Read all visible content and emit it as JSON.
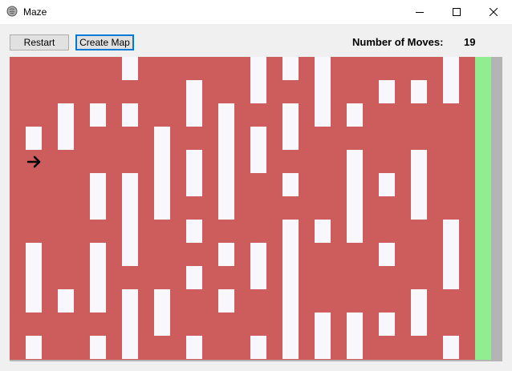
{
  "window": {
    "title": "Maze",
    "app_icon": "brain-icon",
    "controls": [
      "minimize-icon",
      "maximize-icon",
      "close-icon"
    ]
  },
  "toolbar": {
    "restart_label": "Restart",
    "create_map_label": "Create Map",
    "moves_label": "Number of Moves:",
    "moves_value": "19"
  },
  "maze": {
    "colors": {
      "floor": "#cd5c5c",
      "wall": "#f8f8fc",
      "goal": "#90ee90",
      "border": "#b4b4b4",
      "player": "#000000"
    },
    "player_icon": "arrow-right-icon",
    "player_position": {
      "row": 4,
      "col": 1
    },
    "goal_column": 29,
    "cols": 29,
    "rows": 13,
    "walls": [
      {
        "col": 1,
        "row": 3,
        "h": 1
      },
      {
        "col": 1,
        "row": 8,
        "h": 3
      },
      {
        "col": 1,
        "row": 12,
        "h": 1
      },
      {
        "col": 3,
        "row": 2,
        "h": 2
      },
      {
        "col": 3,
        "row": 10,
        "h": 1
      },
      {
        "col": 5,
        "row": 2,
        "h": 1
      },
      {
        "col": 5,
        "row": 5,
        "h": 2
      },
      {
        "col": 5,
        "row": 8,
        "h": 3
      },
      {
        "col": 5,
        "row": 12,
        "h": 1
      },
      {
        "col": 7,
        "row": 0,
        "h": 1
      },
      {
        "col": 7,
        "row": 2,
        "h": 1
      },
      {
        "col": 7,
        "row": 5,
        "h": 4
      },
      {
        "col": 7,
        "row": 10,
        "h": 3
      },
      {
        "col": 9,
        "row": 3,
        "h": 4
      },
      {
        "col": 9,
        "row": 10,
        "h": 2
      },
      {
        "col": 11,
        "row": 1,
        "h": 2
      },
      {
        "col": 11,
        "row": 4,
        "h": 2
      },
      {
        "col": 11,
        "row": 7,
        "h": 1
      },
      {
        "col": 11,
        "row": 9,
        "h": 1
      },
      {
        "col": 11,
        "row": 12,
        "h": 1
      },
      {
        "col": 13,
        "row": 2,
        "h": 5
      },
      {
        "col": 13,
        "row": 8,
        "h": 1
      },
      {
        "col": 13,
        "row": 10,
        "h": 1
      },
      {
        "col": 15,
        "row": 0,
        "h": 2
      },
      {
        "col": 15,
        "row": 3,
        "h": 2
      },
      {
        "col": 15,
        "row": 8,
        "h": 2
      },
      {
        "col": 15,
        "row": 12,
        "h": 1
      },
      {
        "col": 17,
        "row": 0,
        "h": 1
      },
      {
        "col": 17,
        "row": 2,
        "h": 2
      },
      {
        "col": 17,
        "row": 5,
        "h": 1
      },
      {
        "col": 17,
        "row": 7,
        "h": 6
      },
      {
        "col": 19,
        "row": 0,
        "h": 3
      },
      {
        "col": 19,
        "row": 7,
        "h": 1
      },
      {
        "col": 19,
        "row": 11,
        "h": 2
      },
      {
        "col": 21,
        "row": 2,
        "h": 1
      },
      {
        "col": 21,
        "row": 4,
        "h": 4
      },
      {
        "col": 21,
        "row": 11,
        "h": 2
      },
      {
        "col": 23,
        "row": 1,
        "h": 1
      },
      {
        "col": 23,
        "row": 5,
        "h": 1
      },
      {
        "col": 23,
        "row": 8,
        "h": 1
      },
      {
        "col": 23,
        "row": 11,
        "h": 1
      },
      {
        "col": 25,
        "row": 1,
        "h": 1
      },
      {
        "col": 25,
        "row": 4,
        "h": 3
      },
      {
        "col": 25,
        "row": 10,
        "h": 2
      },
      {
        "col": 27,
        "row": 0,
        "h": 2
      },
      {
        "col": 27,
        "row": 7,
        "h": 3
      },
      {
        "col": 27,
        "row": 12,
        "h": 1
      }
    ]
  }
}
